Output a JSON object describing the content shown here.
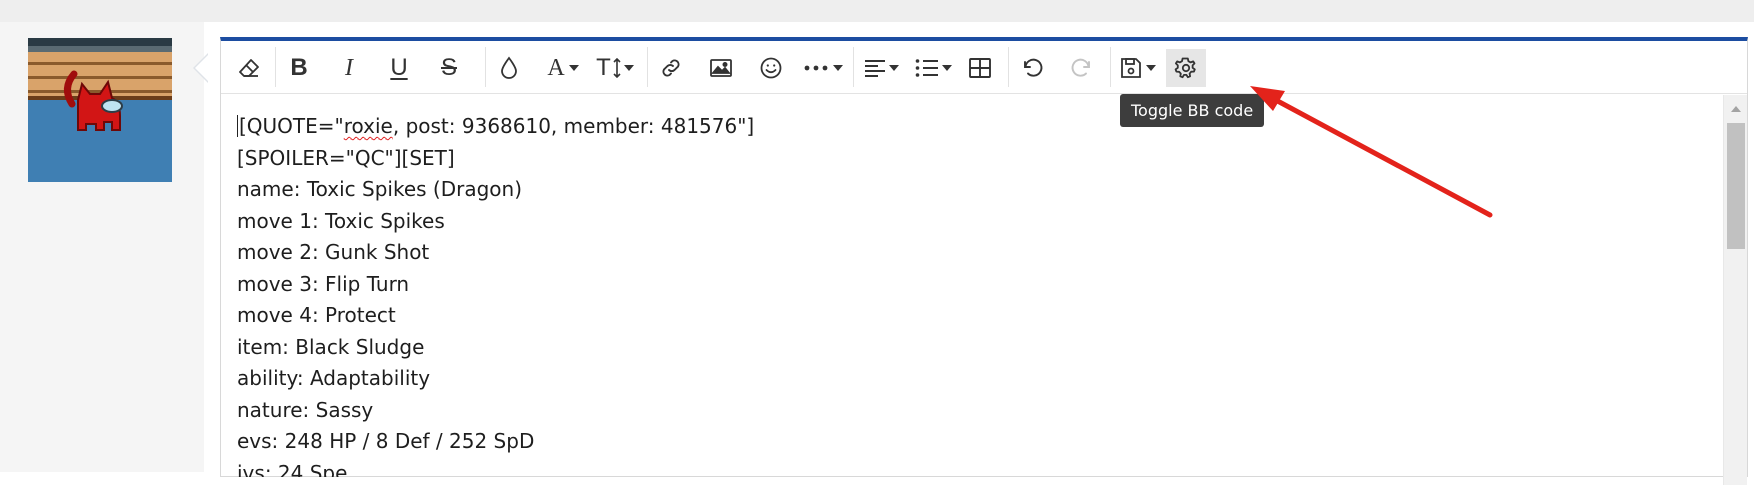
{
  "toolbar": {
    "buttons": [
      {
        "name": "remove-formatting",
        "icon": "eraser-icon"
      },
      {
        "name": "bold",
        "icon": "bold-icon",
        "glyph": "B"
      },
      {
        "name": "italic",
        "icon": "italic-icon",
        "glyph": "I"
      },
      {
        "name": "underline",
        "icon": "underline-icon",
        "glyph": "U"
      },
      {
        "name": "strikethrough",
        "icon": "strikethrough-icon",
        "glyph": "S"
      },
      {
        "name": "text-color",
        "icon": "droplet-icon"
      },
      {
        "name": "font-family",
        "icon": "font-family-icon",
        "glyph": "A"
      },
      {
        "name": "font-size",
        "icon": "font-size-icon",
        "glyph": "T"
      },
      {
        "name": "insert-link",
        "icon": "link-icon"
      },
      {
        "name": "insert-image",
        "icon": "image-icon"
      },
      {
        "name": "smilies",
        "icon": "smiley-icon"
      },
      {
        "name": "more-options",
        "icon": "ellipsis-icon"
      },
      {
        "name": "alignment",
        "icon": "align-left-icon"
      },
      {
        "name": "list",
        "icon": "list-icon"
      },
      {
        "name": "insert-table",
        "icon": "table-icon"
      },
      {
        "name": "undo",
        "icon": "undo-icon"
      },
      {
        "name": "redo",
        "icon": "redo-icon"
      },
      {
        "name": "drafts",
        "icon": "floppy-disk-icon"
      },
      {
        "name": "toggle-bb-code",
        "icon": "gear-icon",
        "active": true
      }
    ],
    "tooltip": "Toggle BB code"
  },
  "editor": {
    "lines": [
      "[QUOTE=\"roxie, post: 9368610, member: 481576\"]",
      "[SPOILER=\"QC\"][SET]",
      "name: Toxic Spikes (Dragon)",
      "move 1: Toxic Spikes",
      "move 2: Gunk Shot",
      "move 3: Flip Turn",
      "move 4: Protect",
      "item: Black Sludge",
      "ability: Adaptability",
      "nature: Sassy",
      "evs: 248 HP / 8 Def / 252 SpD",
      "ivs: 24 Spe"
    ],
    "first_line_parts": [
      "[QUOTE=\"",
      "roxie",
      ", post: 9368610, member: 481576\"]"
    ]
  },
  "colors": {
    "accent": "#1c4da1",
    "annotation_arrow": "#e3231b",
    "tooltip_bg": "#3d3d3d",
    "avatar_bg": "#3f7fb3",
    "crewmate": "#d21515"
  }
}
